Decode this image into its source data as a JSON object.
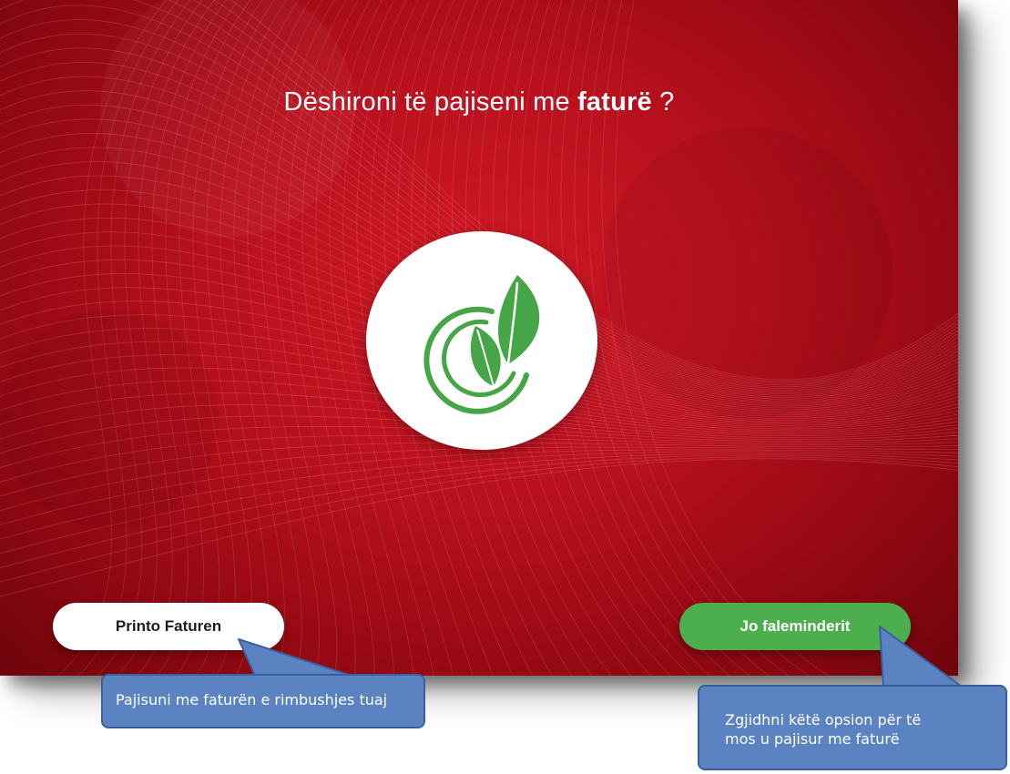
{
  "screen": {
    "question_prefix": "Dëshironi të pajiseni me ",
    "question_bold": "faturë",
    "question_suffix": " ?",
    "logo_icon": "leaf-swirl-icon",
    "accent_red": "#b8101d",
    "accent_green": "#4cae4c"
  },
  "buttons": {
    "print_label": "Printo Faturen",
    "no_thanks_label": "Jo faleminderit"
  },
  "callouts": {
    "print_hint": "Pajisuni me faturën e rimbushjes tuaj",
    "no_thanks_hint_line1": "Zgjidhni këtë opsion për të",
    "no_thanks_hint_line2": "mos u pajisur me faturë",
    "callout_color": "#5b83c2"
  }
}
